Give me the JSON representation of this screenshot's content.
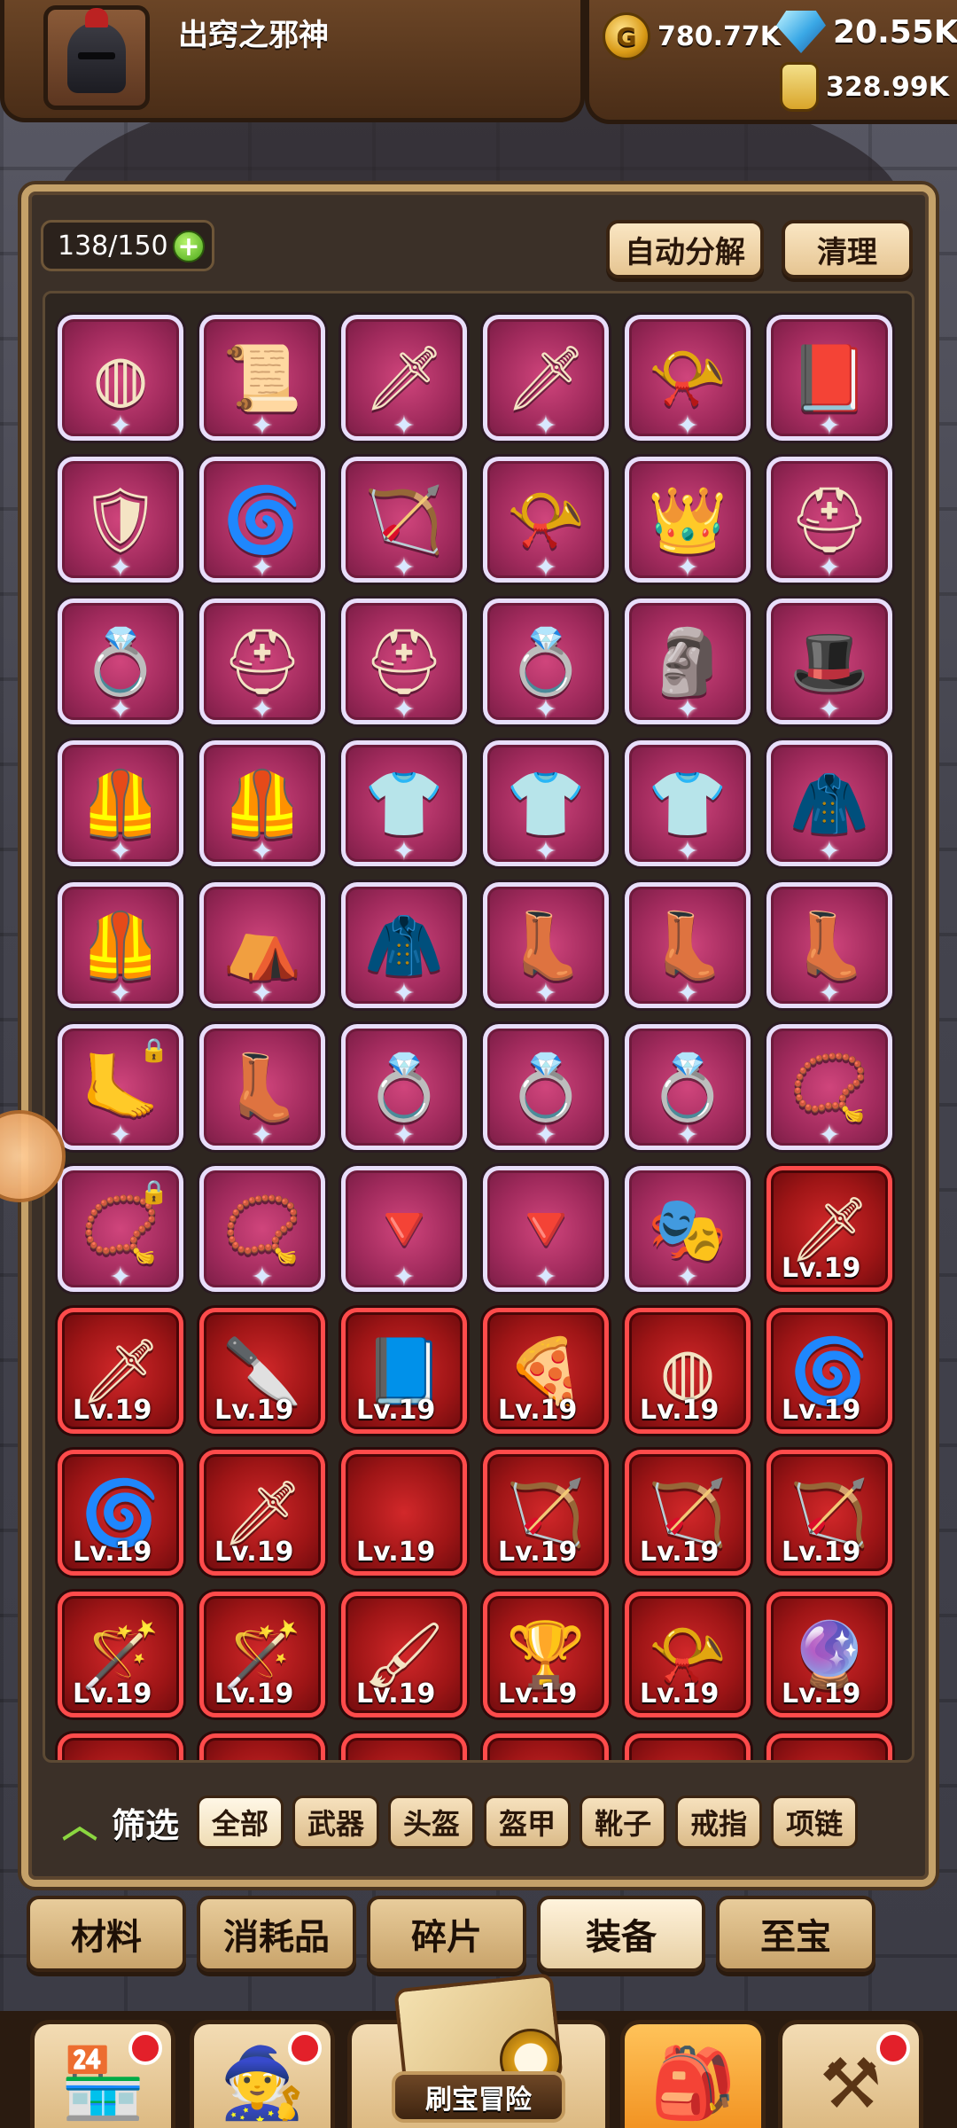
{
  "player": {
    "name": "出窍之邪神"
  },
  "resources": {
    "gold": "780.77K",
    "gems": "20.55K",
    "potion": "328.99K"
  },
  "inventory": {
    "capacity": "138/150",
    "auto_decompose_label": "自动分解",
    "clear_label": "清理",
    "items": [
      {
        "icon": "pie-icon",
        "glyph": "◍",
        "rarity": "purple"
      },
      {
        "icon": "scroll-icon",
        "glyph": "📜",
        "rarity": "purple"
      },
      {
        "icon": "fire-sword-icon",
        "glyph": "🗡",
        "rarity": "purple"
      },
      {
        "icon": "sword-icon",
        "glyph": "🗡",
        "rarity": "purple"
      },
      {
        "icon": "horn-icon",
        "glyph": "📯",
        "rarity": "purple"
      },
      {
        "icon": "book-icon",
        "glyph": "📕",
        "rarity": "purple"
      },
      {
        "icon": "shield-icon",
        "glyph": "🛡",
        "rarity": "purple"
      },
      {
        "icon": "spiral-disc-icon",
        "glyph": "🌀",
        "rarity": "purple"
      },
      {
        "icon": "bow-icon",
        "glyph": "🏹",
        "rarity": "purple"
      },
      {
        "icon": "horn-icon",
        "glyph": "📯",
        "rarity": "purple"
      },
      {
        "icon": "crowned-duck-icon",
        "glyph": "👑",
        "rarity": "purple"
      },
      {
        "icon": "helmet-icon",
        "glyph": "⛑",
        "rarity": "purple"
      },
      {
        "icon": "ring-icon",
        "glyph": "💍",
        "rarity": "purple"
      },
      {
        "icon": "hardhat-icon",
        "glyph": "⛑",
        "rarity": "purple"
      },
      {
        "icon": "helmet-icon",
        "glyph": "⛑",
        "rarity": "purple"
      },
      {
        "icon": "ring-icon",
        "glyph": "💍",
        "rarity": "purple"
      },
      {
        "icon": "bust-helmet-icon",
        "glyph": "🗿",
        "rarity": "purple"
      },
      {
        "icon": "hood-icon",
        "glyph": "🎩",
        "rarity": "purple"
      },
      {
        "icon": "armor-icon",
        "glyph": "🦺",
        "rarity": "purple"
      },
      {
        "icon": "cape-armor-icon",
        "glyph": "🦺",
        "rarity": "purple"
      },
      {
        "icon": "shirt-icon",
        "glyph": "👕",
        "rarity": "purple"
      },
      {
        "icon": "fur-vest-icon",
        "glyph": "👕",
        "rarity": "purple"
      },
      {
        "icon": "fur-vest-icon",
        "glyph": "👕",
        "rarity": "purple"
      },
      {
        "icon": "santa-suit-icon",
        "glyph": "🧥",
        "rarity": "purple"
      },
      {
        "icon": "gold-armor-icon",
        "glyph": "🦺",
        "rarity": "purple"
      },
      {
        "icon": "cloth-icon",
        "glyph": "⛺",
        "rarity": "purple"
      },
      {
        "icon": "green-cape-icon",
        "glyph": "🧥",
        "rarity": "purple"
      },
      {
        "icon": "boot-icon",
        "glyph": "👢",
        "rarity": "purple"
      },
      {
        "icon": "boot-icon",
        "glyph": "👢",
        "rarity": "purple"
      },
      {
        "icon": "boot-icon",
        "glyph": "👢",
        "rarity": "purple"
      },
      {
        "icon": "claw-boot-icon",
        "glyph": "🦶",
        "rarity": "purple",
        "locked": true
      },
      {
        "icon": "leather-boot-icon",
        "glyph": "👢",
        "rarity": "purple"
      },
      {
        "icon": "dragon-ring-icon",
        "glyph": "💍",
        "rarity": "purple"
      },
      {
        "icon": "dragon-ring-icon",
        "glyph": "💍",
        "rarity": "purple"
      },
      {
        "icon": "gem-ring-icon",
        "glyph": "💍",
        "rarity": "purple"
      },
      {
        "icon": "bead-necklace-icon",
        "glyph": "📿",
        "rarity": "purple"
      },
      {
        "icon": "bead-necklace-icon",
        "glyph": "📿",
        "rarity": "purple",
        "locked": true
      },
      {
        "icon": "star-necklace-icon",
        "glyph": "📿",
        "rarity": "purple"
      },
      {
        "icon": "pendant-icon",
        "glyph": "🔻",
        "rarity": "purple"
      },
      {
        "icon": "pendant-icon",
        "glyph": "🔻",
        "rarity": "purple"
      },
      {
        "icon": "mask-icon",
        "glyph": "🎭",
        "rarity": "purple"
      },
      {
        "icon": "blue-sword-icon",
        "glyph": "🗡",
        "rarity": "red",
        "level": "Lv.19"
      },
      {
        "icon": "blue-sword-icon",
        "glyph": "🗡",
        "rarity": "red",
        "level": "Lv.19"
      },
      {
        "icon": "knife-icon",
        "glyph": "🔪",
        "rarity": "red",
        "level": "Lv.19"
      },
      {
        "icon": "book-icon",
        "glyph": "📘",
        "rarity": "red",
        "level": "Lv.19"
      },
      {
        "icon": "pizza-icon",
        "glyph": "🍕",
        "rarity": "red",
        "level": "Lv.19"
      },
      {
        "icon": "pie-icon",
        "glyph": "◍",
        "rarity": "red",
        "level": "Lv.19"
      },
      {
        "icon": "spiral-disc-icon",
        "glyph": "🌀",
        "rarity": "red",
        "level": "Lv.19"
      },
      {
        "icon": "spiral-disc-icon",
        "glyph": "🌀",
        "rarity": "red",
        "level": "Lv.19"
      },
      {
        "icon": "sword-icon",
        "glyph": "🗡",
        "rarity": "red",
        "level": "Lv.19"
      },
      {
        "icon": "empty-slot-icon",
        "glyph": "",
        "rarity": "red",
        "level": "Lv.19"
      },
      {
        "icon": "crossbow-icon",
        "glyph": "🏹",
        "rarity": "red",
        "level": "Lv.19"
      },
      {
        "icon": "crossbow-icon",
        "glyph": "🏹",
        "rarity": "red",
        "level": "Lv.19"
      },
      {
        "icon": "bow-icon",
        "glyph": "🏹",
        "rarity": "red",
        "level": "Lv.19"
      },
      {
        "icon": "star-wand-icon",
        "glyph": "🪄",
        "rarity": "red",
        "level": "Lv.19"
      },
      {
        "icon": "star-wand-icon",
        "glyph": "🪄",
        "rarity": "red",
        "level": "Lv.19"
      },
      {
        "icon": "brush-icon",
        "glyph": "🖌",
        "rarity": "red",
        "level": "Lv.19"
      },
      {
        "icon": "chalice-icon",
        "glyph": "🏆",
        "rarity": "red",
        "level": "Lv.19"
      },
      {
        "icon": "horn-icon",
        "glyph": "📯",
        "rarity": "red",
        "level": "Lv.19"
      },
      {
        "icon": "orb-staff-icon",
        "glyph": "🔮",
        "rarity": "red",
        "level": "Lv.19"
      }
    ]
  },
  "filter": {
    "label": "筛选",
    "chips": [
      "全部",
      "武器",
      "头盔",
      "盔甲",
      "靴子",
      "戒指",
      "项链"
    ],
    "active_index": 0
  },
  "categories": {
    "tabs": [
      "材料",
      "消耗品",
      "碎片",
      "装备",
      "至宝"
    ],
    "active_index": 3
  },
  "bottom_nav": {
    "adventure_label": "刷宝冒险",
    "items": [
      {
        "icon": "shop-icon",
        "badge": true
      },
      {
        "icon": "hero-icon",
        "badge": true
      },
      {
        "icon": "adventure-icon",
        "badge": false
      },
      {
        "icon": "backpack-icon",
        "badge": false,
        "active": true
      },
      {
        "icon": "forge-icon",
        "badge": true
      }
    ]
  }
}
